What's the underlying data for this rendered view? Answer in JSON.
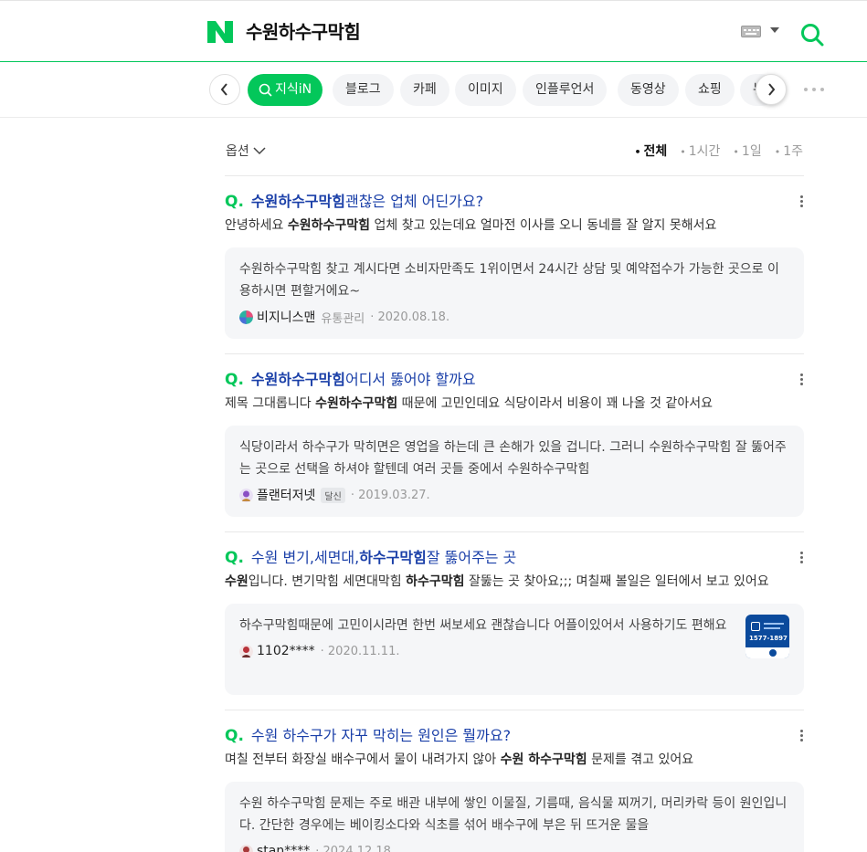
{
  "header": {
    "query": "수원하수구막힘",
    "brand_color": "#03c75a"
  },
  "tabs": {
    "items": [
      {
        "label": "지식iN",
        "active": true
      },
      {
        "label": "블로그"
      },
      {
        "label": "카페"
      },
      {
        "label": "이미지"
      },
      {
        "label": "인플루언서"
      },
      {
        "label": "동영상"
      },
      {
        "label": "쇼핑"
      },
      {
        "label": "뉴"
      }
    ]
  },
  "options": {
    "label": "옵션",
    "periods": [
      "전체",
      "1시간",
      "1일",
      "1주"
    ]
  },
  "results": [
    {
      "title_q": "Q.",
      "title_bold": "수원하수구막힘",
      "title_rest": " 괜찮은 업체 어딘가요?",
      "desc_pre": "안녕하세요 ",
      "desc_bold": "수원하수구막힘",
      "desc_post": " 업체 찾고 있는데요 얼마전 이사를 오니 동네를 잘 알지 못해서요",
      "answer": "수원하수구막힘 찾고 계시다면 소비자만족도 1위이면서 24시간 상담 및 예약접수가 가능한 곳으로 이용하시면 편할거에요~",
      "author": "비지니스맨",
      "author_sub": "유통관리",
      "date": "· 2020.08.18."
    },
    {
      "title_q": "Q.",
      "title_bold": "수원하수구막힘",
      "title_rest": " 어디서 뚫어야 할까요",
      "desc_pre": "제목 그대롭니다 ",
      "desc_bold": "수원하수구막힘",
      "desc_post": " 때문에 고민인데요 식당이라서 비용이 꽤 나올 것 같아서요",
      "answer": "식당이라서 하수구가 막히면은 영업을 하는데 큰 손해가 있을 겁니다. 그러니 수원하수구막힘 잘 뚫어주는 곳으로 선택을 하셔야 할텐데 여러 곳들 중에서 수원하수구막힘",
      "author": "플랜터저넷",
      "badge": "달신",
      "date": "· 2019.03.27."
    },
    {
      "title_q": "Q.",
      "title_pre": "수원 변기,세면대,",
      "title_bold": "하수구막힘",
      "title_rest": " 잘 뚫어주는 곳",
      "desc_bold_first": "수원",
      "desc_pre": "입니다. 변기막힘 세면대막힘 ",
      "desc_bold": "하수구막힘",
      "desc_post": " 잘뚫는 곳 찾아요;;; 며칠째 볼일은 일터에서 보고 있어요",
      "answer": "하수구막힘때문에 고민이시라면 한번 써보세요 괜찮습니다 어플이있어서 사용하기도 편해요",
      "author": "1102****",
      "date": "· 2020.11.11.",
      "thumb_text": "1577-1897"
    },
    {
      "title_q": "Q.",
      "title_rest": "수원 하수구가 자꾸 막히는 원인은 뭘까요?",
      "desc_pre": "며칠 전부터 화장실 배수구에서 물이 내려가지 않아 ",
      "desc_bold": "수원 하수구막힘",
      "desc_post": " 문제를 겪고 있어요",
      "answer": "수원 하수구막힘 문제는 주로 배관 내부에 쌓인 이물질, 기름때, 음식물 찌꺼기, 머리카락 등이 원인입니다. 간단한 경우에는 베이킹소다와 식초를 섞어 배수구에 부은 뒤 뜨거운 물을",
      "author": "stan****",
      "date": "· 2024.12.18."
    }
  ]
}
